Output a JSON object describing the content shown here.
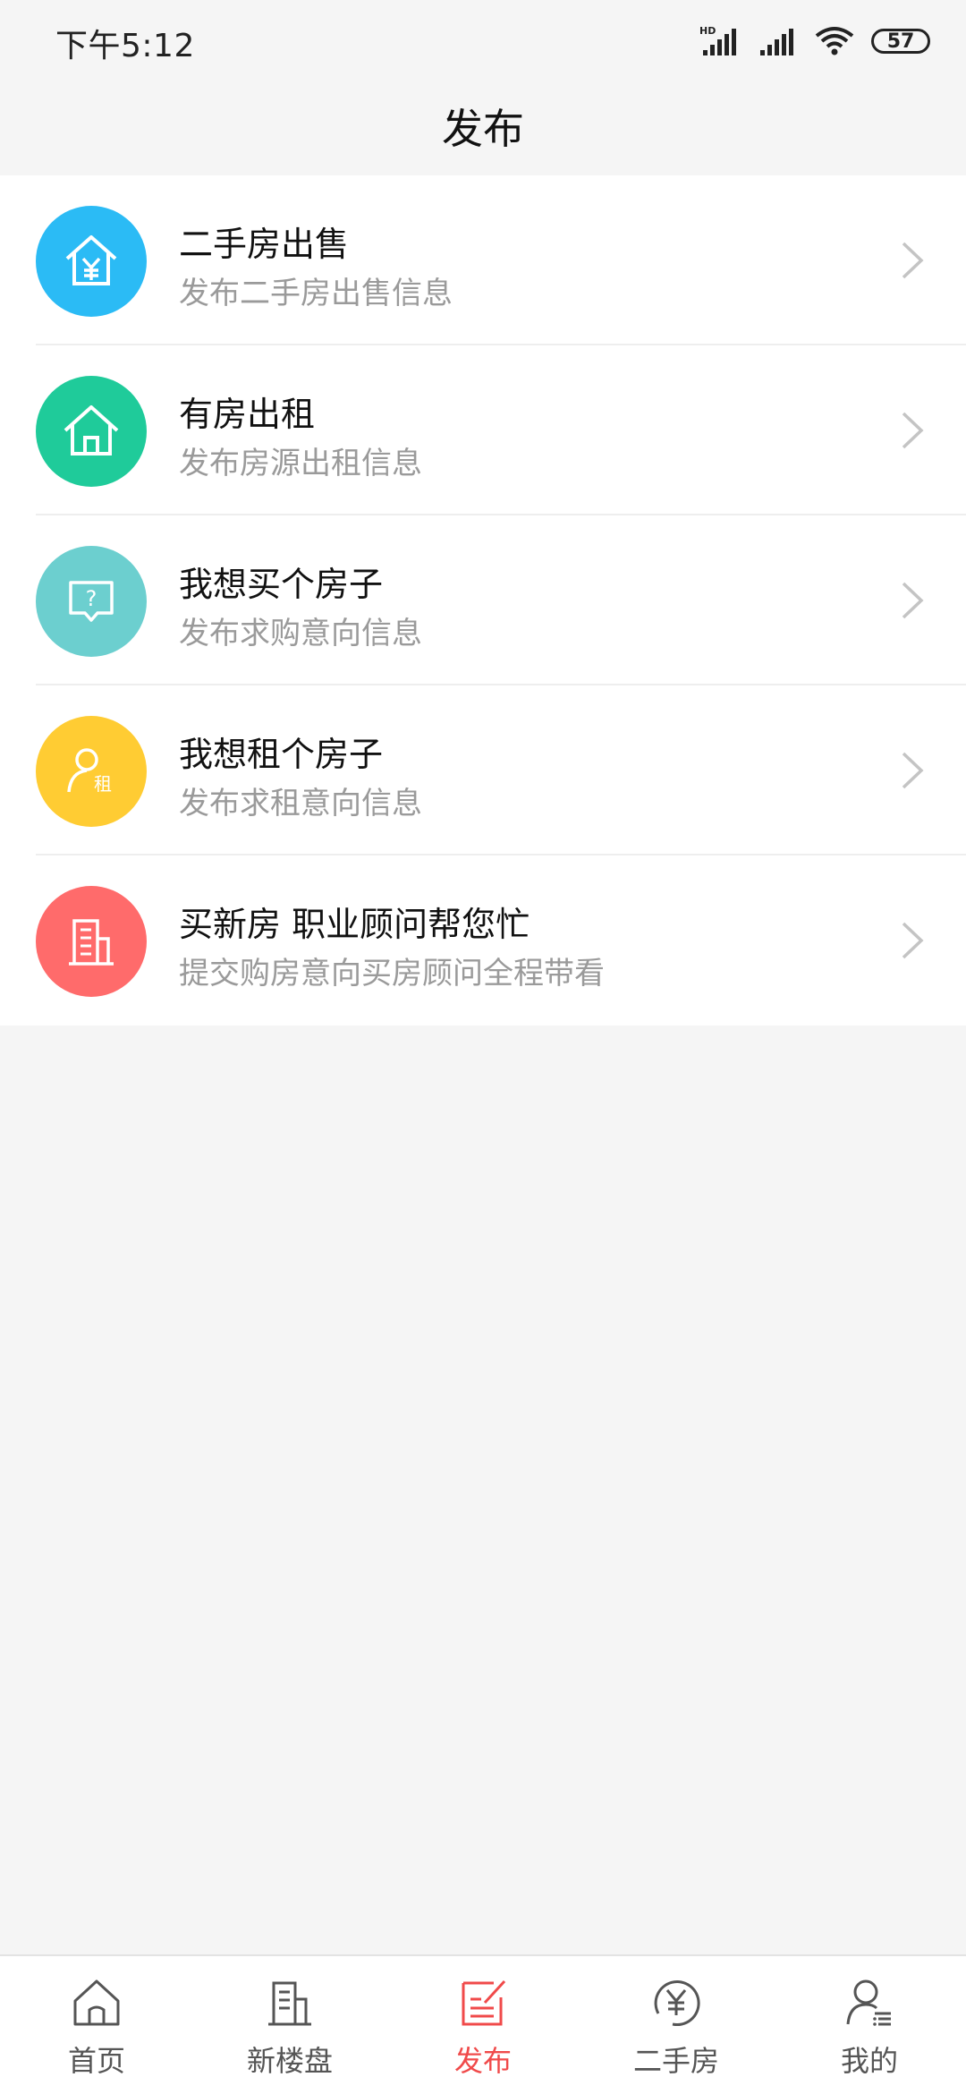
{
  "status_bar": {
    "time": "下午5:12",
    "battery": "57"
  },
  "header": {
    "title": "发布"
  },
  "list": [
    {
      "title": "二手房出售",
      "subtitle": "发布二手房出售信息",
      "icon": "house-yen-icon",
      "color": "#2bbbf5"
    },
    {
      "title": "有房出租",
      "subtitle": "发布房源出租信息",
      "icon": "house-icon",
      "color": "#1fcb9a"
    },
    {
      "title": "我想买个房子",
      "subtitle": "发布求购意向信息",
      "icon": "question-bubble-icon",
      "color": "#6ccfcf"
    },
    {
      "title": "我想租个房子",
      "subtitle": "发布求租意向信息",
      "icon": "person-rent-icon",
      "color": "#ffcc33",
      "icon_text": "租"
    },
    {
      "title": "买新房 职业顾问帮您忙",
      "subtitle": "提交购房意向买房顾问全程带看",
      "icon": "building-icon",
      "color": "#ff6b6b"
    }
  ],
  "bottom_nav": [
    {
      "label": "首页",
      "icon": "home-icon"
    },
    {
      "label": "新楼盘",
      "icon": "building-icon"
    },
    {
      "label": "发布",
      "icon": "edit-icon",
      "active": true
    },
    {
      "label": "二手房",
      "icon": "yen-circle-icon"
    },
    {
      "label": "我的",
      "icon": "user-icon"
    }
  ],
  "colors": {
    "active": "#f04a4a",
    "inactive": "#555555"
  }
}
